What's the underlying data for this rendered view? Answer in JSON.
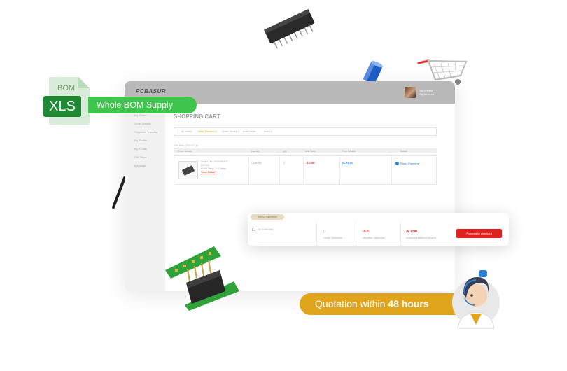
{
  "window": {
    "logo": "PCBASUR",
    "profile": {
      "name": "Ms.Kristen",
      "role": "My Account"
    },
    "sidebar": [
      "My Order",
      "Order Details",
      "Shipment Tracking",
      "My Profile",
      "My E-mall",
      "Gift Ships",
      "Message"
    ],
    "page_title": "SHOPPING CART",
    "tabs": [
      {
        "label": "All Orders",
        "active": false
      },
      {
        "label": "Pass, Payment 3",
        "active": true
      },
      {
        "label": "Under Review 0",
        "active": false
      },
      {
        "label": "Audit Failed",
        "active": false
      },
      {
        "label": "Invest 0",
        "active": false
      }
    ],
    "add_time": "Add Time: 2020-03-26",
    "table_headers": [
      "Order Details",
      "Quantity",
      "Qty",
      "Unit Total",
      "Price Details",
      "Status"
    ],
    "row": {
      "order_no": "Order No: 4b464042F",
      "order_sub": "(NOW)",
      "build_time": "Build Time: 1-2 days",
      "view_detail": "View Detail",
      "quantity": "Quantity",
      "qty": "1",
      "price": "-$ 1.00",
      "bom_link": "BOM xls",
      "status": "Pass, Payment"
    }
  },
  "panel": {
    "pill": "Add to Shipments",
    "select_all": "All Selected",
    "orders_selected_value": "0",
    "orders_selected_label": "Order Selected",
    "discount_value": "-$ 0",
    "discount_label": "Member Discount",
    "amount_value": "-$ 1:00",
    "amount_label": "Amount (Without freight)",
    "checkout_label": "Proceed to checkout"
  },
  "bom": {
    "file_label": "BOM",
    "xls": "XLS",
    "caption": "Whole BOM Supply"
  },
  "quote": {
    "prefix": "Quotation within ",
    "emphasis": "48 hours"
  },
  "colors": {
    "green": "#3fc44c",
    "dark_green": "#1f8a33",
    "orange": "#e0a51c",
    "red": "#e02020",
    "link": "#2f7fd8"
  },
  "icons": [
    "microchip-icon",
    "capacitor-icon",
    "shopping-cart-icon",
    "transistor-icon",
    "resistor-icon",
    "pcb-connector-icon",
    "support-agent-icon"
  ]
}
